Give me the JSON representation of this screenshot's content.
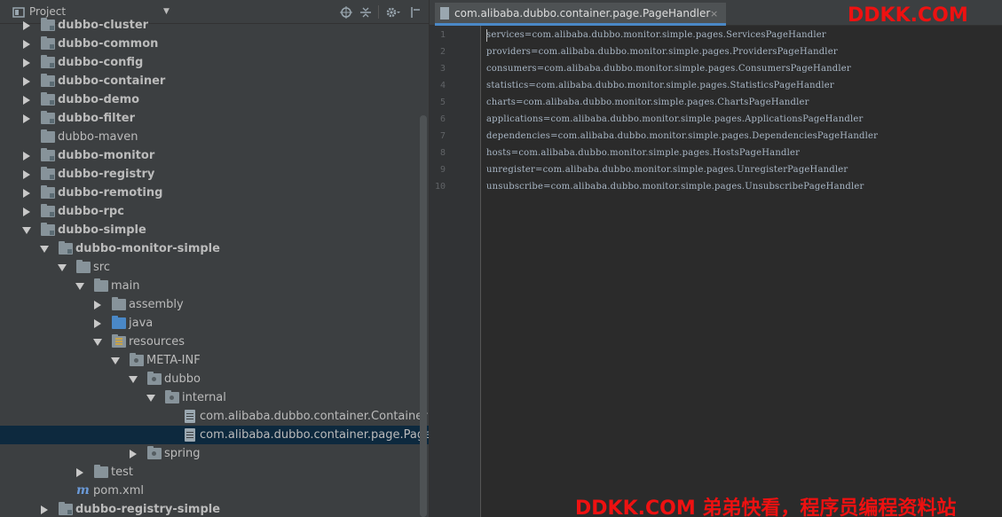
{
  "project_panel": {
    "title": "Project",
    "tree": [
      {
        "label": "dubbo-cluster",
        "bold": true,
        "arrow": "collapsed",
        "icon": "folder-module"
      },
      {
        "label": "dubbo-common",
        "bold": true,
        "arrow": "collapsed",
        "icon": "folder-module"
      },
      {
        "label": "dubbo-config",
        "bold": true,
        "arrow": "collapsed",
        "icon": "folder-module"
      },
      {
        "label": "dubbo-container",
        "bold": true,
        "arrow": "collapsed",
        "icon": "folder-module"
      },
      {
        "label": "dubbo-demo",
        "bold": true,
        "arrow": "collapsed",
        "icon": "folder-module"
      },
      {
        "label": "dubbo-filter",
        "bold": true,
        "arrow": "collapsed",
        "icon": "folder-module"
      },
      {
        "label": "dubbo-maven",
        "bold": false,
        "arrow": "none",
        "icon": "folder"
      },
      {
        "label": "dubbo-monitor",
        "bold": true,
        "arrow": "collapsed",
        "icon": "folder-module"
      },
      {
        "label": "dubbo-registry",
        "bold": true,
        "arrow": "collapsed",
        "icon": "folder-module"
      },
      {
        "label": "dubbo-remoting",
        "bold": true,
        "arrow": "collapsed",
        "icon": "folder-module"
      },
      {
        "label": "dubbo-rpc",
        "bold": true,
        "arrow": "collapsed",
        "icon": "folder-module"
      },
      {
        "label": "dubbo-simple",
        "bold": true,
        "arrow": "expanded",
        "icon": "folder-module"
      },
      {
        "label": "dubbo-monitor-simple",
        "bold": true,
        "arrow": "expanded",
        "icon": "folder-module"
      },
      {
        "label": "src",
        "bold": false,
        "arrow": "expanded",
        "icon": "folder"
      },
      {
        "label": "main",
        "bold": false,
        "arrow": "expanded",
        "icon": "folder"
      },
      {
        "label": "assembly",
        "bold": false,
        "arrow": "collapsed",
        "icon": "folder"
      },
      {
        "label": "java",
        "bold": false,
        "arrow": "collapsed",
        "icon": "folder-source"
      },
      {
        "label": "resources",
        "bold": false,
        "arrow": "expanded",
        "icon": "folder-resources"
      },
      {
        "label": "META-INF",
        "bold": false,
        "arrow": "expanded",
        "icon": "folder-package"
      },
      {
        "label": "dubbo",
        "bold": false,
        "arrow": "expanded",
        "icon": "folder-package"
      },
      {
        "label": "internal",
        "bold": false,
        "arrow": "expanded",
        "icon": "folder-package"
      },
      {
        "label": "com.alibaba.dubbo.container.Container",
        "bold": false,
        "arrow": "none",
        "icon": "file"
      },
      {
        "label": "com.alibaba.dubbo.container.page.PageHan",
        "bold": false,
        "arrow": "none",
        "icon": "file",
        "selected": true
      },
      {
        "label": "spring",
        "bold": false,
        "arrow": "collapsed",
        "icon": "folder-package"
      },
      {
        "label": "test",
        "bold": false,
        "arrow": "collapsed",
        "icon": "folder"
      },
      {
        "label": "pom.xml",
        "bold": false,
        "arrow": "none",
        "icon": "maven"
      },
      {
        "label": "dubbo-registry-simple",
        "bold": true,
        "arrow": "collapsed",
        "icon": "folder-module"
      }
    ]
  },
  "editor": {
    "tab_label": "com.alibaba.dubbo.container.page.PageHandler",
    "tab_close": "×",
    "lines": [
      {
        "num": "1",
        "text": "services=com.alibaba.dubbo.monitor.simple.pages.ServicesPageHandler"
      },
      {
        "num": "2",
        "text": "providers=com.alibaba.dubbo.monitor.simple.pages.ProvidersPageHandler"
      },
      {
        "num": "3",
        "text": "consumers=com.alibaba.dubbo.monitor.simple.pages.ConsumersPageHandler"
      },
      {
        "num": "4",
        "text": "statistics=com.alibaba.dubbo.monitor.simple.pages.StatisticsPageHandler"
      },
      {
        "num": "5",
        "text": "charts=com.alibaba.dubbo.monitor.simple.pages.ChartsPageHandler"
      },
      {
        "num": "6",
        "text": "applications=com.alibaba.dubbo.monitor.simple.pages.ApplicationsPageHandler"
      },
      {
        "num": "7",
        "text": "dependencies=com.alibaba.dubbo.monitor.simple.pages.DependenciesPageHandler"
      },
      {
        "num": "8",
        "text": "hosts=com.alibaba.dubbo.monitor.simple.pages.HostsPageHandler"
      },
      {
        "num": "9",
        "text": "unregister=com.alibaba.dubbo.monitor.simple.pages.UnregisterPageHandler"
      },
      {
        "num": "10",
        "text": "unsubscribe=com.alibaba.dubbo.monitor.simple.pages.UnsubscribePageHandler"
      }
    ]
  },
  "watermarks": {
    "top": "DDKK.COM",
    "bottom": "DDKK.COM 弟弟快看，程序员编程资料站"
  },
  "colors": {
    "panel_bg": "#3c3f41",
    "editor_bg": "#2b2b2b",
    "selection": "#0d293e",
    "watermark": "#ee1111"
  }
}
